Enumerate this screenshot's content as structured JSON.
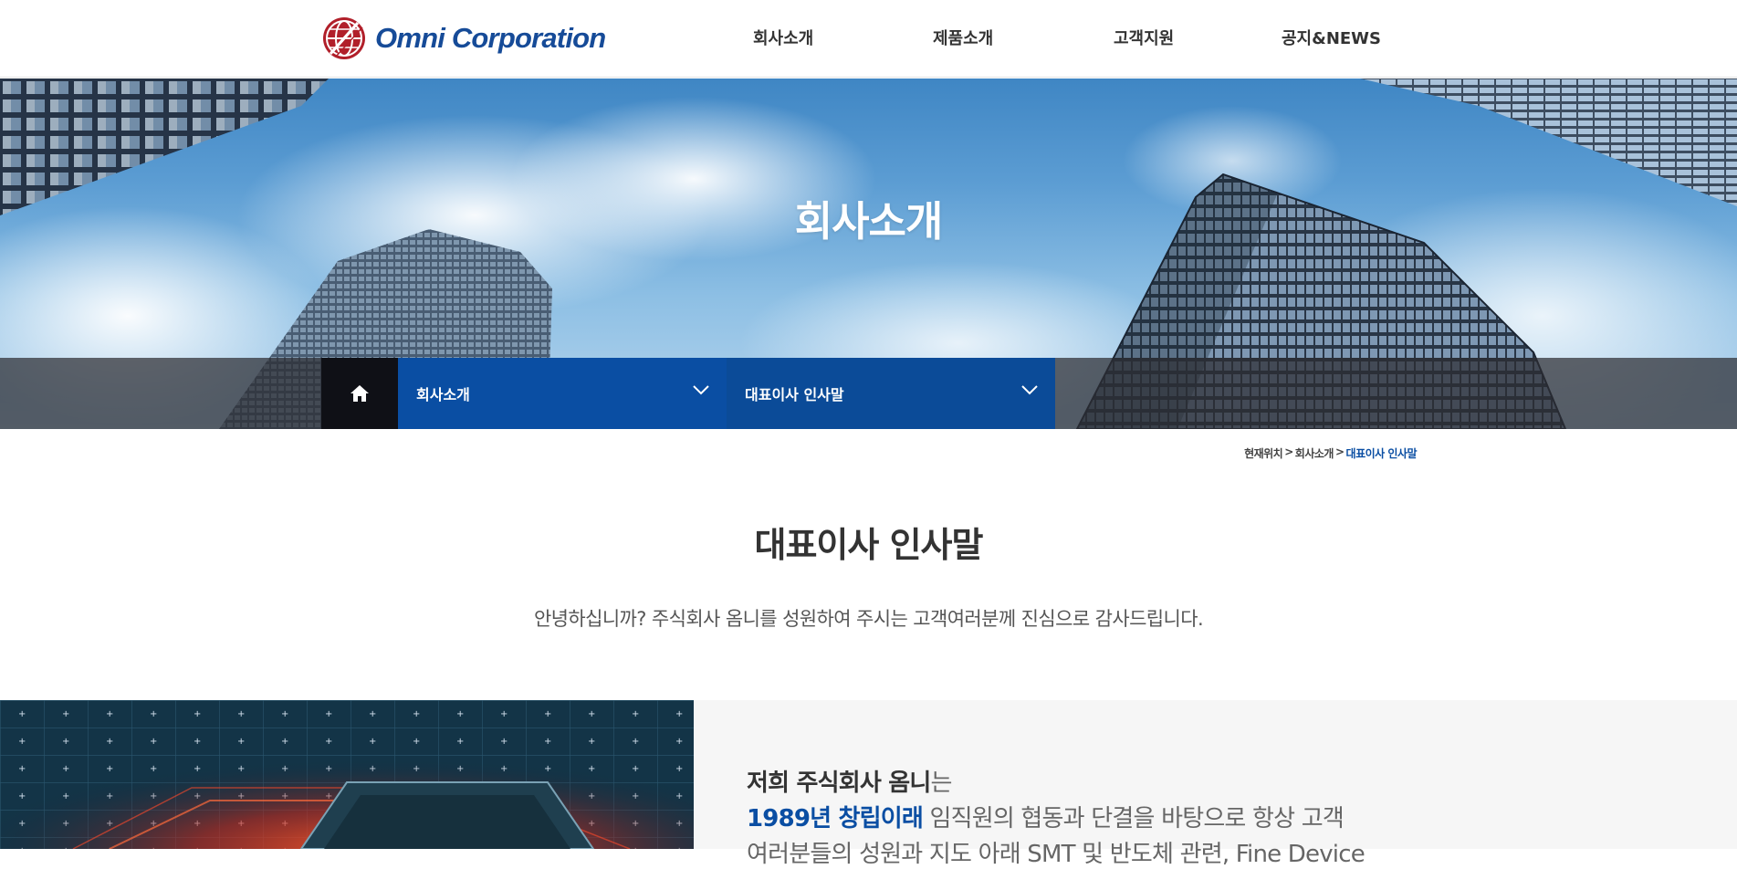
{
  "header": {
    "logo_text": "Omni Corporation",
    "nav": [
      "회사소개",
      "제품소개",
      "고객지원",
      "공지&NEWS"
    ]
  },
  "hero": {
    "title": "회사소개",
    "home_icon": "home-icon",
    "dropdown1": "회사소개",
    "dropdown2": "대표이사 인사말"
  },
  "breadcrumb": {
    "items": [
      "현재위치",
      "회사소개",
      "대표이사 인사말"
    ],
    "separator": ">"
  },
  "content": {
    "title": "대표이사 인사말",
    "greeting": "안녕하십니까? 주식회사 옴니를 성원하여 주시는 고객여러분께 진심으로 감사드립니다.",
    "feature": {
      "line1_strong": "저희 주식회사 옴니",
      "line1_rest": "는",
      "line2_strong": "1989년 창립이래",
      "line2_rest": " 임직원의 협동과 단결을 바탕으로 항상 고객",
      "line3": "여러분들의 성원과 지도 아래 SMT 및 반도체 관련, Fine Device"
    }
  },
  "colors": {
    "brand_blue": "#0a4ea3",
    "logo_red": "#b11f2a",
    "home_bg": "#0f1016"
  }
}
